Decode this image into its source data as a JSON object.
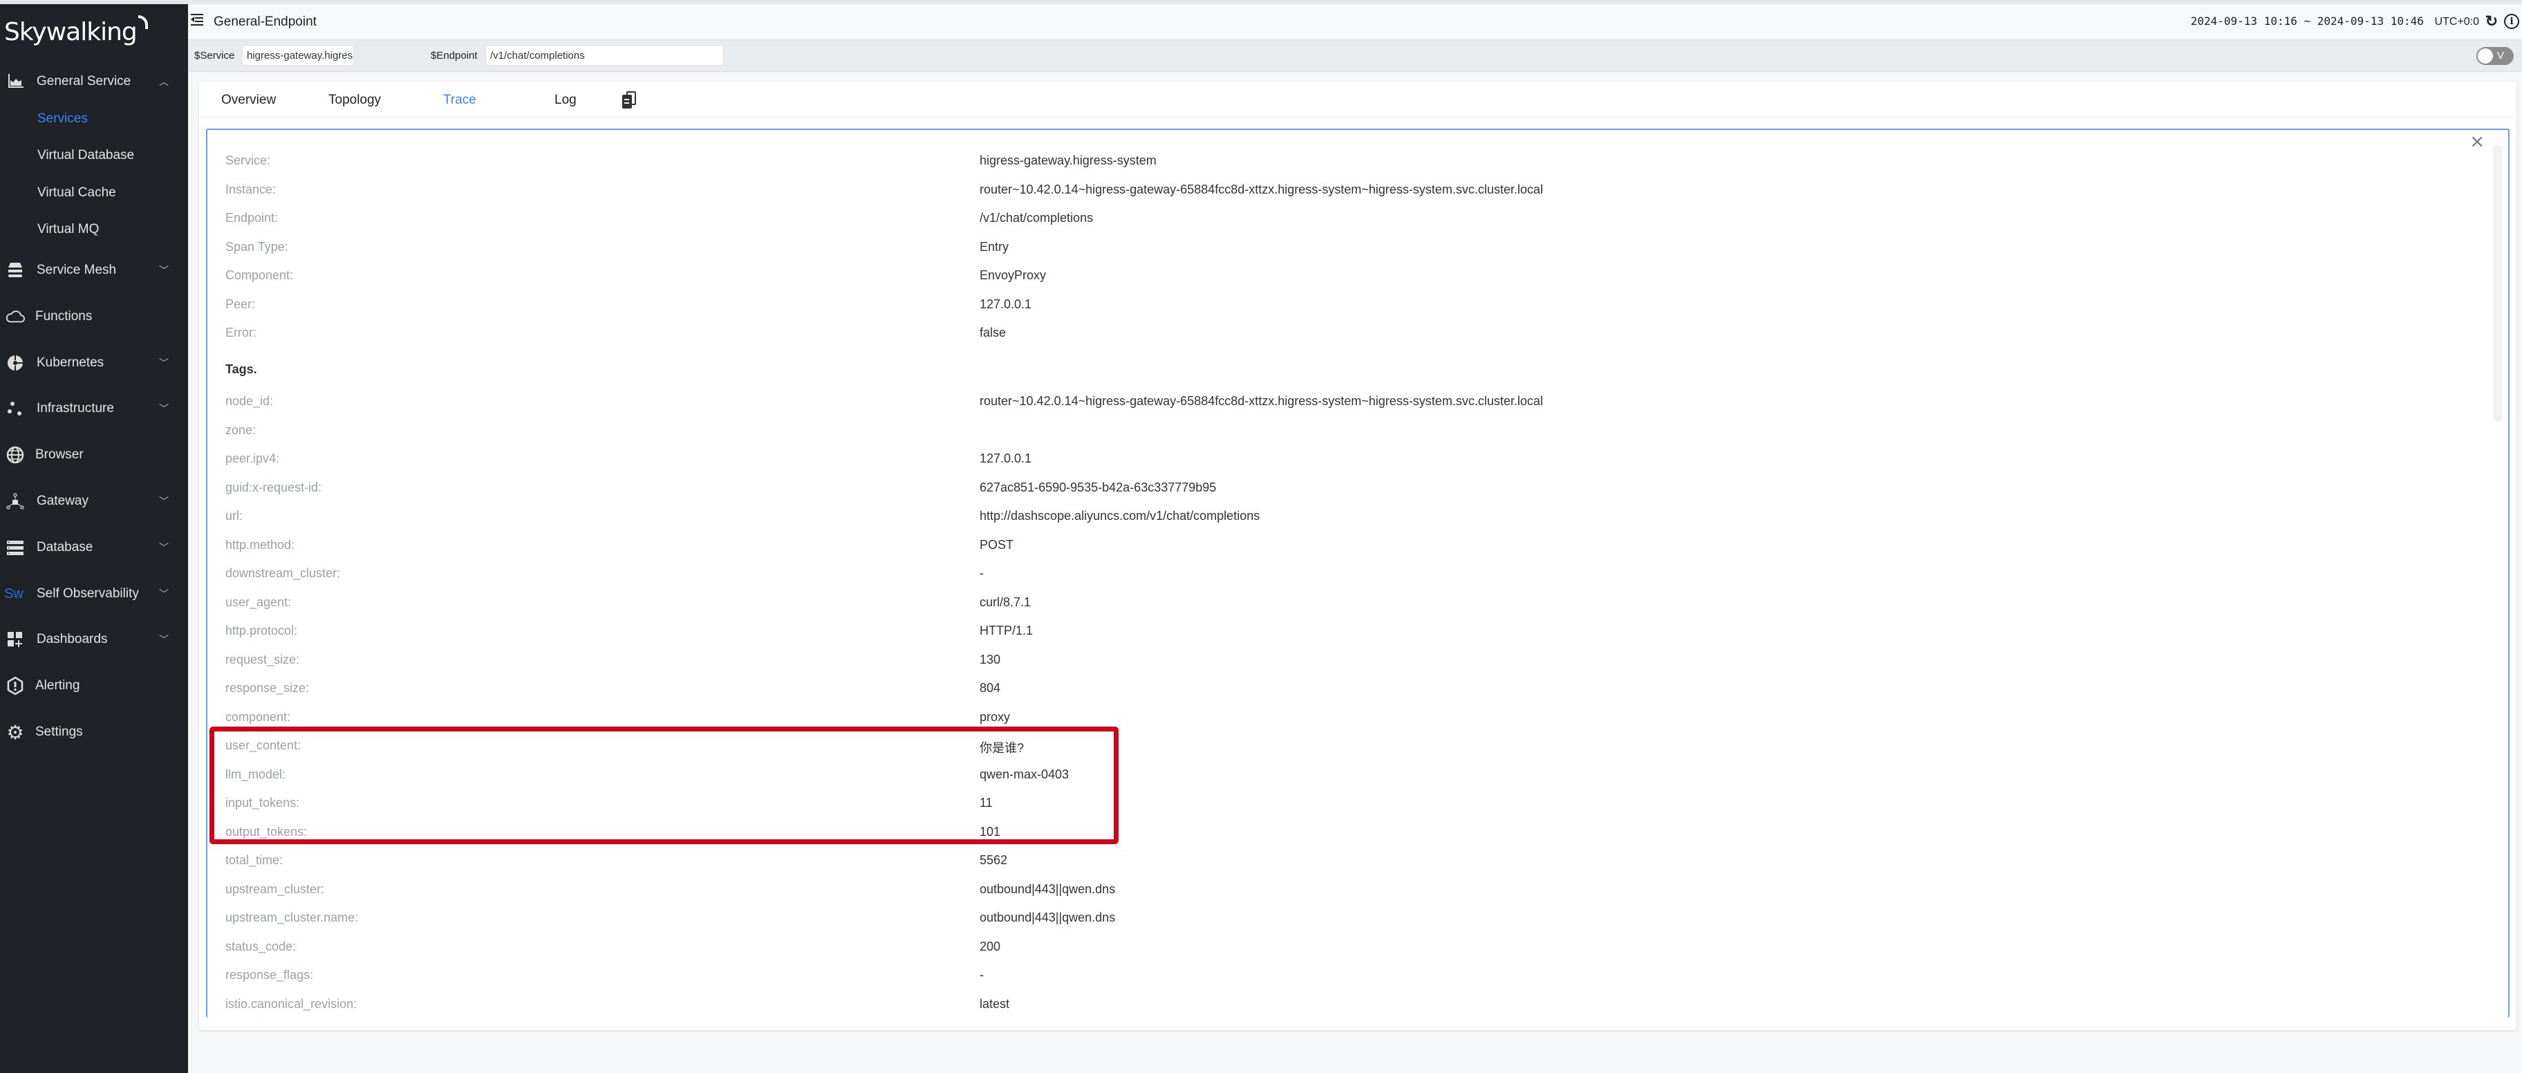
{
  "app": {
    "logo_text": "Skywalking"
  },
  "sidebar": {
    "items": [
      {
        "label": "General Service",
        "icon": "chart-area-icon",
        "expanded": true
      },
      {
        "label": "Services",
        "active": true
      },
      {
        "label": "Virtual Database"
      },
      {
        "label": "Virtual Cache"
      },
      {
        "label": "Virtual MQ"
      },
      {
        "label": "Service Mesh",
        "icon": "service-mesh-icon"
      },
      {
        "label": "Functions",
        "icon": "cloud-icon"
      },
      {
        "label": "Kubernetes",
        "icon": "kubernetes-icon"
      },
      {
        "label": "Infrastructure",
        "icon": "infrastructure-icon"
      },
      {
        "label": "Browser",
        "icon": "globe-icon"
      },
      {
        "label": "Gateway",
        "icon": "gateway-icon"
      },
      {
        "label": "Database",
        "icon": "database-icon"
      },
      {
        "label": "Self Observability",
        "icon": "skywalking-sw-icon",
        "icon_text": "Sw"
      },
      {
        "label": "Dashboards",
        "icon": "dashboard-add-icon"
      },
      {
        "label": "Alerting",
        "icon": "alert-icon"
      },
      {
        "label": "Settings",
        "icon": "gear-icon"
      }
    ]
  },
  "header": {
    "title": "General-Endpoint",
    "time_range": "2024-09-13 10:16 ~ 2024-09-13 10:46",
    "timezone": "UTC+0:0",
    "reload_icon": "↻",
    "info_icon": "i"
  },
  "filters": {
    "service_label": "$Service",
    "service_value": "higress-gateway.higress-system",
    "endpoint_label": "$Endpoint",
    "endpoint_value": "/v1/chat/completions",
    "toggle_label": "V"
  },
  "tabs": [
    {
      "label": "Overview"
    },
    {
      "label": "Topology"
    },
    {
      "label": "Trace",
      "active": true
    },
    {
      "label": "Log"
    }
  ],
  "span_detail": {
    "close_icon": "×",
    "fields": [
      {
        "key": "Service:",
        "value": "higress-gateway.higress-system"
      },
      {
        "key": "Instance:",
        "value": "router~10.42.0.14~higress-gateway-65884fcc8d-xttzx.higress-system~higress-system.svc.cluster.local"
      },
      {
        "key": "Endpoint:",
        "value": "/v1/chat/completions"
      },
      {
        "key": "Span Type:",
        "value": "Entry"
      },
      {
        "key": "Component:",
        "value": "EnvoyProxy"
      },
      {
        "key": "Peer:",
        "value": "127.0.0.1"
      },
      {
        "key": "Error:",
        "value": "false"
      }
    ],
    "tags_heading": "Tags.",
    "tags": [
      {
        "key": "node_id:",
        "value": "router~10.42.0.14~higress-gateway-65884fcc8d-xttzx.higress-system~higress-system.svc.cluster.local"
      },
      {
        "key": "zone:",
        "value": ""
      },
      {
        "key": "peer.ipv4:",
        "value": "127.0.0.1"
      },
      {
        "key": "guid:x-request-id:",
        "value": "627ac851-6590-9535-b42a-63c337779b95"
      },
      {
        "key": "url:",
        "value": "http://dashscope.aliyuncs.com/v1/chat/completions"
      },
      {
        "key": "http.method:",
        "value": "POST"
      },
      {
        "key": "downstream_cluster:",
        "value": "-"
      },
      {
        "key": "user_agent:",
        "value": "curl/8.7.1"
      },
      {
        "key": "http.protocol:",
        "value": "HTTP/1.1"
      },
      {
        "key": "request_size:",
        "value": "130"
      },
      {
        "key": "response_size:",
        "value": "804"
      },
      {
        "key": "component:",
        "value": "proxy"
      },
      {
        "key": "user_content:",
        "value": "你是谁?",
        "highlighted": true
      },
      {
        "key": "llm_model:",
        "value": "qwen-max-0403",
        "highlighted": true
      },
      {
        "key": "input_tokens:",
        "value": "11",
        "highlighted": true
      },
      {
        "key": "output_tokens:",
        "value": "101",
        "highlighted": true
      },
      {
        "key": "total_time:",
        "value": "5562"
      },
      {
        "key": "upstream_cluster:",
        "value": "outbound|443||qwen.dns"
      },
      {
        "key": "upstream_cluster.name:",
        "value": "outbound|443||qwen.dns"
      },
      {
        "key": "status_code:",
        "value": "200"
      },
      {
        "key": "response_flags:",
        "value": "-"
      },
      {
        "key": "istio.canonical_revision:",
        "value": "latest"
      }
    ]
  },
  "colors": {
    "accent": "#3d86f6",
    "sidebar_bg": "#1f2226",
    "highlight": "#d0021b",
    "label": "#9aa0ad"
  }
}
